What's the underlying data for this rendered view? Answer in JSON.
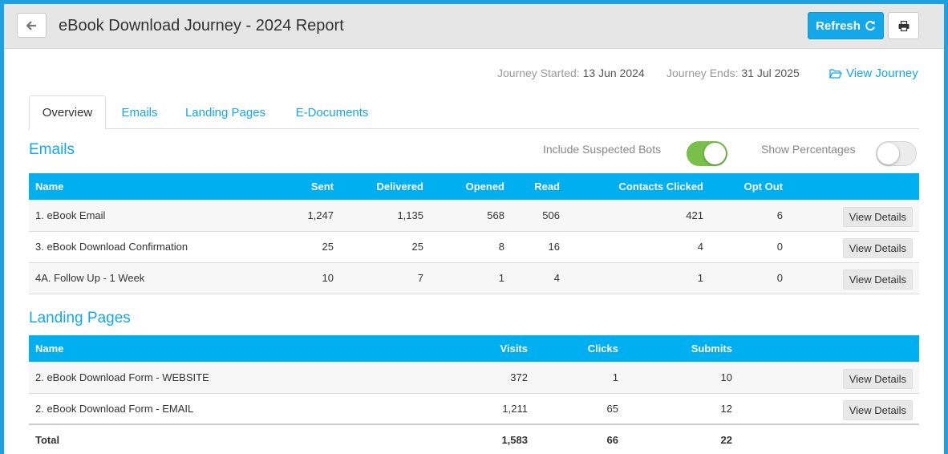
{
  "header": {
    "title": "eBook Download Journey - 2024 Report",
    "refresh_label": "Refresh",
    "accent": "#13a8ea"
  },
  "journey": {
    "started_label": "Journey Started:",
    "started_value": "13 Jun 2024",
    "ends_label": "Journey Ends:",
    "ends_value": "31 Jul 2025",
    "view_label": "View Journey"
  },
  "tabs": [
    {
      "label": "Overview",
      "active": true
    },
    {
      "label": "Emails",
      "active": false
    },
    {
      "label": "Landing Pages",
      "active": false
    },
    {
      "label": "E-Documents",
      "active": false
    }
  ],
  "emails": {
    "title": "Emails",
    "toggle_bots_label": "Include Suspected Bots",
    "toggle_bots_on": true,
    "toggle_pct_label": "Show Percentages",
    "toggle_pct_on": false,
    "columns": [
      "Name",
      "Sent",
      "Delivered",
      "Opened",
      "Read",
      "Contacts Clicked",
      "Opt Out"
    ],
    "rows": [
      {
        "name": "1. eBook Email",
        "sent": "1,247",
        "delivered": "1,135",
        "opened": "568",
        "read": "506",
        "clicked": "421",
        "optout": "6",
        "action": "View Details"
      },
      {
        "name": "3. eBook Download Confirmation",
        "sent": "25",
        "delivered": "25",
        "opened": "8",
        "read": "16",
        "clicked": "4",
        "optout": "0",
        "action": "View Details"
      },
      {
        "name": "4A. Follow Up - 1 Week",
        "sent": "10",
        "delivered": "7",
        "opened": "1",
        "read": "4",
        "clicked": "1",
        "optout": "0",
        "action": "View Details"
      }
    ]
  },
  "landing": {
    "title": "Landing Pages",
    "columns": [
      "Name",
      "Visits",
      "Clicks",
      "Submits"
    ],
    "rows": [
      {
        "name": "2. eBook Download Form - WEBSITE",
        "visits": "372",
        "clicks": "1",
        "submits": "10",
        "action": "View Details"
      },
      {
        "name": "2. eBook Download Form - EMAIL",
        "visits": "1,211",
        "clicks": "65",
        "submits": "12",
        "action": "View Details"
      }
    ],
    "total": {
      "name": "Total",
      "visits": "1,583",
      "clicks": "66",
      "submits": "22"
    }
  }
}
